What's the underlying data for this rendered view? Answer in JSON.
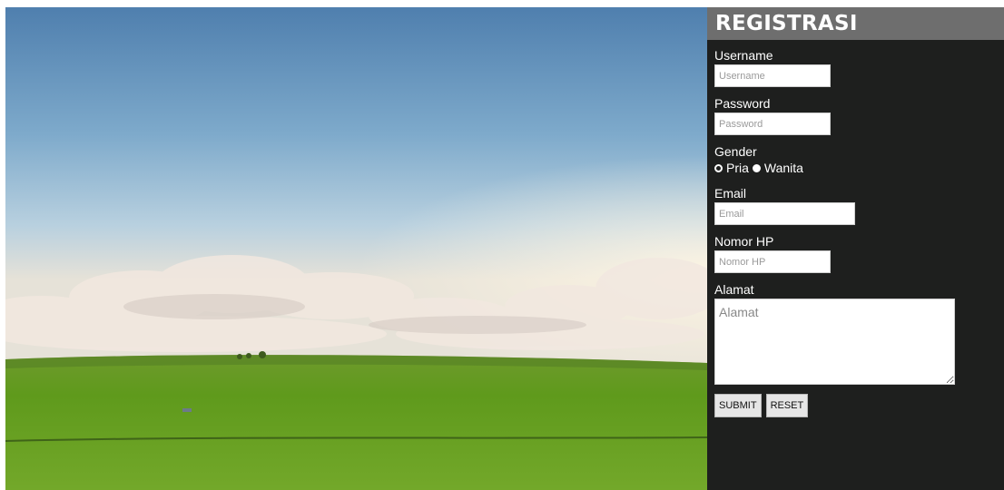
{
  "form": {
    "title": "REGISTRASI",
    "username": {
      "label": "Username",
      "placeholder": "Username"
    },
    "password": {
      "label": "Password",
      "placeholder": "Password"
    },
    "gender": {
      "label": "Gender",
      "options": [
        "Pria",
        "Wanita"
      ],
      "selected": "Wanita"
    },
    "email": {
      "label": "Email",
      "placeholder": "Email"
    },
    "phone": {
      "label": "Nomor HP",
      "placeholder": "Nomor HP"
    },
    "address": {
      "label": "Alamat",
      "placeholder": "Alamat"
    },
    "submit_label": "SUBMIT",
    "reset_label": "RESET"
  },
  "colors": {
    "panel_bg": "#1e1f1e",
    "header_bg": "#6e6e6e",
    "text": "#ffffff"
  },
  "background_image": "green-field-landscape"
}
